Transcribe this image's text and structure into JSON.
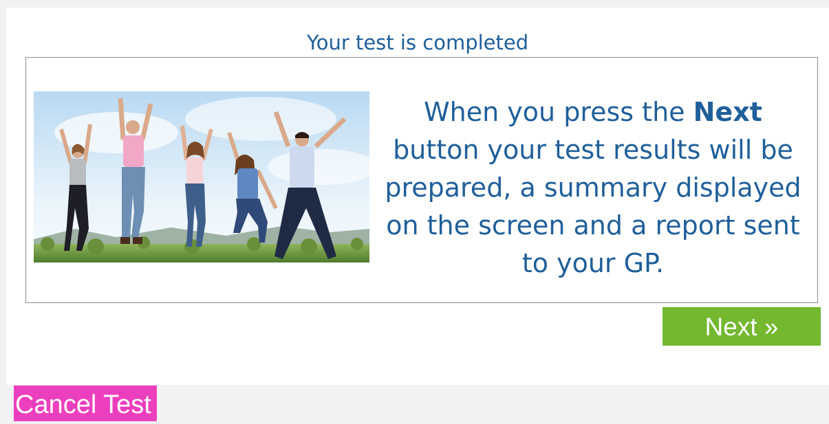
{
  "page": {
    "heading": "Your test is completed"
  },
  "message": {
    "prefix": "When you press the ",
    "emphasis": "Next",
    "suffix": " button your test results will be prepared, a summary displayed on the screen and a report sent to your GP."
  },
  "buttons": {
    "next_label": "Next »",
    "cancel_label": "Cancel Test"
  },
  "colors": {
    "heading_text": "#1f5f9a",
    "next_button": "#73b82f",
    "cancel_button": "#ec3fbe",
    "background": "#f2f2f2"
  },
  "image": {
    "subject": "group-jumping-photo"
  }
}
